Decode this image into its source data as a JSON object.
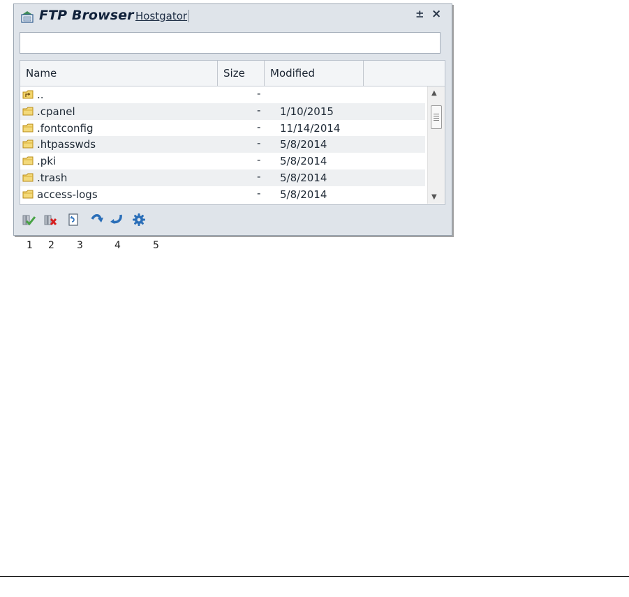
{
  "window": {
    "title": "FTP Browser",
    "site": "Hostgator",
    "pin_icon": "±",
    "close_icon": "×"
  },
  "path": {
    "value": "",
    "placeholder": ""
  },
  "columns": [
    "Name",
    "Size",
    "Modified",
    ""
  ],
  "rows": [
    {
      "name": "..",
      "size": "-",
      "modified": ""
    },
    {
      "name": ".cpanel",
      "size": "-",
      "modified": "1/10/2015"
    },
    {
      "name": ".fontconfig",
      "size": "-",
      "modified": "11/14/2014"
    },
    {
      "name": ".htpasswds",
      "size": "-",
      "modified": "5/8/2014"
    },
    {
      "name": ".pki",
      "size": "-",
      "modified": "5/8/2014"
    },
    {
      "name": ".trash",
      "size": "-",
      "modified": "5/8/2014"
    },
    {
      "name": "access-logs",
      "size": "-",
      "modified": "5/8/2014"
    }
  ],
  "scrollbar": {
    "up_icon": "▲",
    "down_icon": "▼"
  },
  "toolbar_labels": [
    "1",
    "2",
    "3",
    "4",
    "5"
  ],
  "colors": {
    "window_bg": "#dfe4ea",
    "row_alt": "#eef0f2",
    "accent_blue": "#2a6eb8",
    "delete_red": "#d61f1f"
  }
}
